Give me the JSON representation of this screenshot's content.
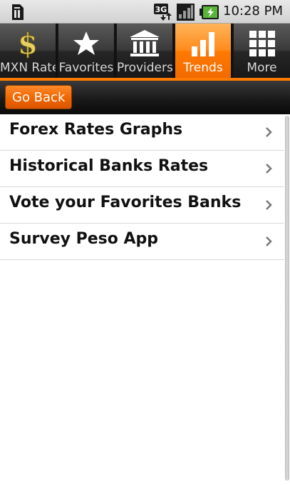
{
  "status_bar": {
    "time": "10:28 PM",
    "icons": [
      "sim-card-icon",
      "3g-data-icon",
      "signal-strength-icon",
      "battery-charging-icon"
    ],
    "network_label": "3G"
  },
  "tabs": [
    {
      "label": "MXN Rates",
      "icon": "dollar-icon",
      "active": false
    },
    {
      "label": "Favorites",
      "icon": "star-icon",
      "active": false
    },
    {
      "label": "Providers",
      "icon": "bank-icon",
      "active": false
    },
    {
      "label": "Trends",
      "icon": "bar-chart-icon",
      "active": true
    },
    {
      "label": "More",
      "icon": "grid-icon",
      "active": false
    }
  ],
  "toolbar": {
    "back_label": "Go Back"
  },
  "menu": {
    "items": [
      {
        "label": "Forex Rates Graphs",
        "icon": "chevron-right-icon"
      },
      {
        "label": "Historical Banks Rates",
        "icon": "chevron-right-icon"
      },
      {
        "label": "Vote your Favorites Banks",
        "icon": "chevron-right-icon"
      },
      {
        "label": "Survey Peso App",
        "icon": "chevron-right-icon"
      }
    ]
  },
  "colors": {
    "accent": "#ff7a00",
    "tab_dark": "#262626",
    "dollar_gold": "#e8d060",
    "status_bar": "#d8d8d8",
    "battery_green": "#5ab43c"
  }
}
